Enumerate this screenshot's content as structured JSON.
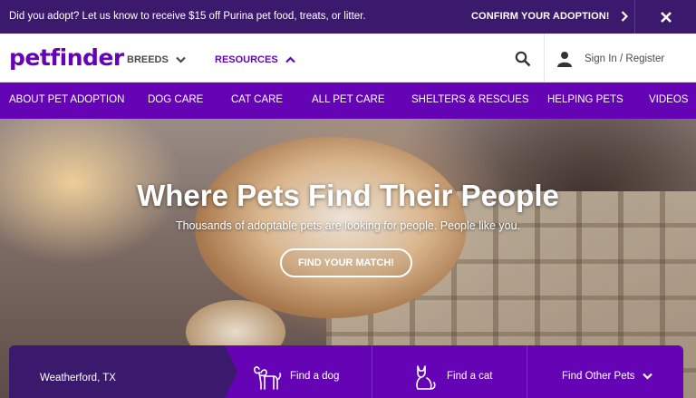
{
  "promo": {
    "text": "Did you adopt? Let us know to receive $15 off Purina pet food, treats, or litter.",
    "cta_label": "CONFIRM YOUR ADOPTION!",
    "close_icon": "close-icon"
  },
  "header": {
    "logo": "petfinder",
    "breeds_label": "BREEDS",
    "resources_label": "RESOURCES",
    "signin_label": "Sign In / Register",
    "search_icon": "search-icon",
    "user_icon": "user-icon"
  },
  "subnav": {
    "items": [
      {
        "label": "ABOUT PET ADOPTION"
      },
      {
        "label": "DOG CARE"
      },
      {
        "label": "CAT CARE"
      },
      {
        "label": "ALL PET CARE"
      },
      {
        "label": "SHELTERS & RESCUES"
      },
      {
        "label": "HELPING PETS"
      },
      {
        "label": "VIDEOS"
      }
    ]
  },
  "hero": {
    "title": "Where Pets Find Their People",
    "subtitle": "Thousands of adoptable pets are looking for people. People like you.",
    "button_label": "FIND YOUR MATCH!"
  },
  "search": {
    "location": "Weatherford, TX",
    "find_dog": "Find a dog",
    "find_cat": "Find a cat",
    "find_other": "Find Other Pets"
  },
  "colors": {
    "brand_purple": "#6504b5",
    "dark_purple": "#3b1a6e"
  }
}
